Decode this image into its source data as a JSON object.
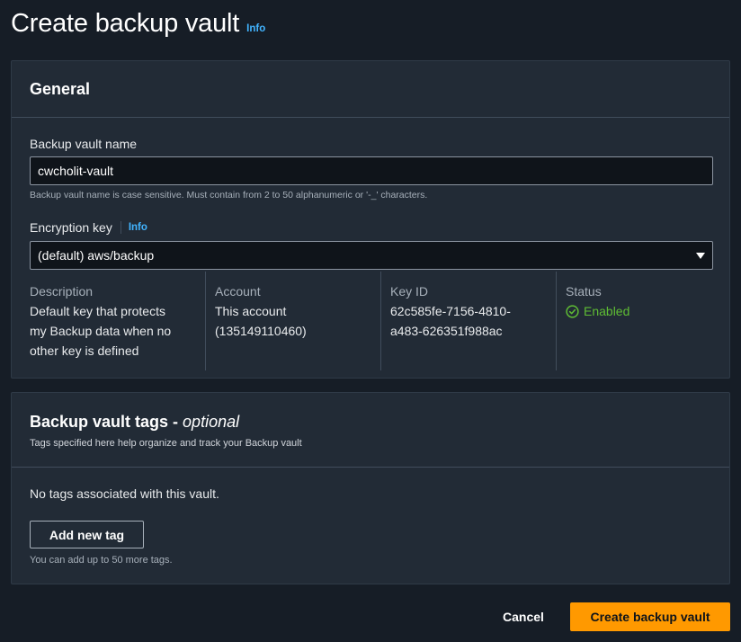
{
  "header": {
    "title": "Create backup vault",
    "info_label": "Info"
  },
  "general": {
    "title": "General",
    "vault_name": {
      "label": "Backup vault name",
      "value": "cwcholit-vault",
      "hint": "Backup vault name is case sensitive. Must contain from 2 to 50 alphanumeric or '-_' characters."
    },
    "encryption_key": {
      "label": "Encryption key",
      "info_label": "Info",
      "selected": "(default) aws/backup",
      "icon": "caret-down-icon"
    },
    "key_details": [
      {
        "key": "Description",
        "lines": [
          "Default key that protects",
          "my Backup data when no",
          "other key is defined"
        ]
      },
      {
        "key": "Account",
        "lines": [
          "This account",
          "(135149110460)"
        ]
      },
      {
        "key": "Key ID",
        "lines": [
          "62c585fe-7156-4810-",
          "a483-626351f988ac"
        ]
      },
      {
        "key": "Status",
        "value": "Enabled",
        "icon": "check-circle-icon",
        "color": "#5fbd34"
      }
    ]
  },
  "tags": {
    "title": "Backup vault tags - ",
    "title_optional": "optional",
    "subtitle": "Tags specified here help organize and track your Backup vault",
    "empty_text": "No tags associated with this vault.",
    "add_button": "Add new tag",
    "hint": "You can add up to 50 more tags."
  },
  "footer": {
    "cancel_label": "Cancel",
    "submit_label": "Create backup vault"
  },
  "colors": {
    "background": "#161d26",
    "panel": "#222b36",
    "primary_button": "#ff9900",
    "link": "#42b4ff"
  }
}
